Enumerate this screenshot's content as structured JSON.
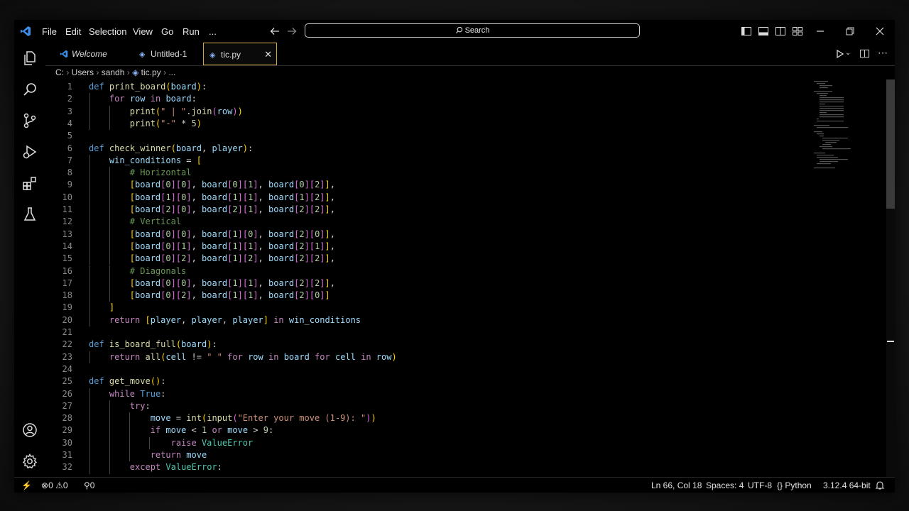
{
  "menu": [
    "File",
    "Edit",
    "Selection",
    "View",
    "Go",
    "Run",
    "..."
  ],
  "search": {
    "label": "Search"
  },
  "tabs": [
    {
      "label": "Welcome",
      "italic": true
    },
    {
      "label": "Untitled-1"
    },
    {
      "label": "tic.py",
      "active": true
    }
  ],
  "breadcrumb": [
    "C:",
    "Users",
    "sandh",
    "tic.py",
    "..."
  ],
  "code_lines": [
    "def print_board(board):",
    "    for row in board:",
    "        print(\" | \".join(row))",
    "        print(\"-\" * 5)",
    "",
    "def check_winner(board, player):",
    "    win_conditions = [",
    "        # Horizontal",
    "        [board[0][0], board[0][1], board[0][2]],",
    "        [board[1][0], board[1][1], board[1][2]],",
    "        [board[2][0], board[2][1], board[2][2]],",
    "        # Vertical",
    "        [board[0][0], board[1][0], board[2][0]],",
    "        [board[0][1], board[1][1], board[2][1]],",
    "        [board[0][2], board[1][2], board[2][2]],",
    "        # Diagonals",
    "        [board[0][0], board[1][1], board[2][2]],",
    "        [board[0][2], board[1][1], board[2][0]]",
    "    ]",
    "    return [player, player, player] in win_conditions",
    "",
    "def is_board_full(board):",
    "    return all(cell != \" \" for row in board for cell in row)",
    "",
    "def get_move():",
    "    while True:",
    "        try:",
    "            move = int(input(\"Enter your move (1-9): \"))",
    "            if move < 1 or move > 9:",
    "                raise ValueError",
    "            return move",
    "        except ValueError:"
  ],
  "status": {
    "errors": "0",
    "warnings": "0",
    "ports": "0",
    "position": "Ln 66, Col 18",
    "spaces": "Spaces: 4",
    "encoding": "UTF-8",
    "language": "Python",
    "interpreter": "3.12.4 64-bit"
  },
  "colors": {
    "accent": "#d7a54a",
    "vscode_blue": "#3b8eea"
  }
}
